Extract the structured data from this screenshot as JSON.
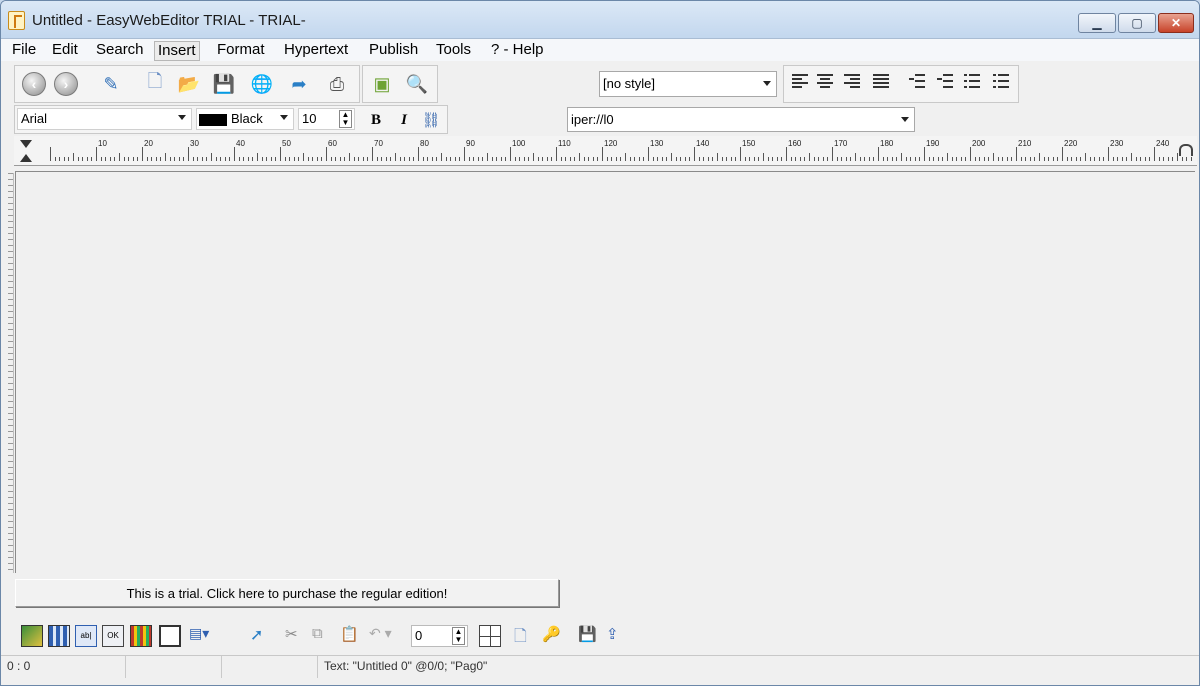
{
  "window": {
    "title": "Untitled - EasyWebEditor TRIAL - TRIAL-"
  },
  "menu": [
    "File",
    "Edit",
    "Search",
    "Insert",
    "Format",
    "Hypertext",
    "Publish",
    "Tools",
    "? - Help"
  ],
  "style_select": {
    "value": "[no style]"
  },
  "font": {
    "name": "Arial",
    "color_name": "Black",
    "color_swatch": "#000000",
    "size": "10"
  },
  "link_field": {
    "value": "iper://l0"
  },
  "ruler": {
    "labels": [
      "10",
      "20",
      "30",
      "40",
      "50",
      "60",
      "70",
      "80",
      "90",
      "100",
      "110",
      "120",
      "130",
      "140",
      "150",
      "160",
      "170",
      "180",
      "190",
      "200",
      "210",
      "220",
      "230",
      "240"
    ]
  },
  "trial_notice": "This is a trial. Click here to purchase the regular edition!",
  "bottom_toolbar": {
    "stepper_value": "0"
  },
  "status": {
    "position": "0 : 0",
    "text": "Text: \"Untitled 0\" @0/0; \"Pag0\""
  },
  "icons": [
    "back-icon",
    "forward-icon",
    "edit-icon",
    "new-file-icon",
    "open-folder-icon",
    "save-icon",
    "globe-publish-icon",
    "share-icon",
    "print-icon",
    "book-icon",
    "magnifier-icon"
  ]
}
